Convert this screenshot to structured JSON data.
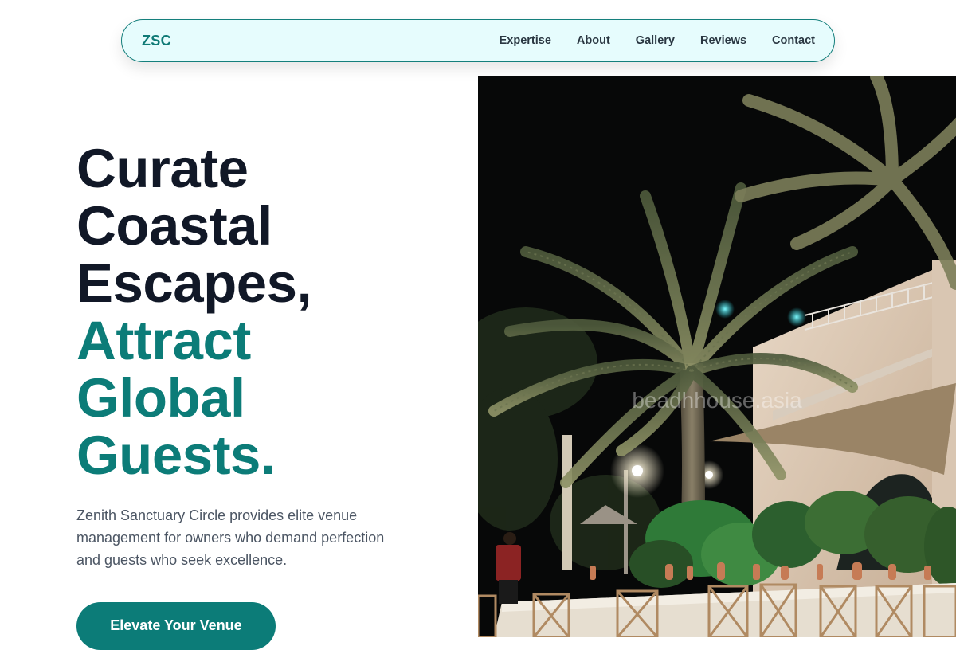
{
  "nav": {
    "logo": "ZSC",
    "links": [
      "Expertise",
      "About",
      "Gallery",
      "Reviews",
      "Contact"
    ]
  },
  "hero": {
    "headline_dark": [
      "Curate",
      "Coastal",
      "Escapes,"
    ],
    "headline_teal": [
      "Attract",
      "Global",
      "Guests."
    ],
    "description": "Zenith Sanctuary Circle provides elite venue management for owners who demand perfection and guests who seek excellence.",
    "cta_label": "Elevate Your Venue",
    "image_watermark": "beadhhouse.asia"
  },
  "colors": {
    "accent": "#0c7c78",
    "nav_bg": "#e6fcfd",
    "headline_dark": "#111827",
    "body_text": "#4b5563"
  }
}
